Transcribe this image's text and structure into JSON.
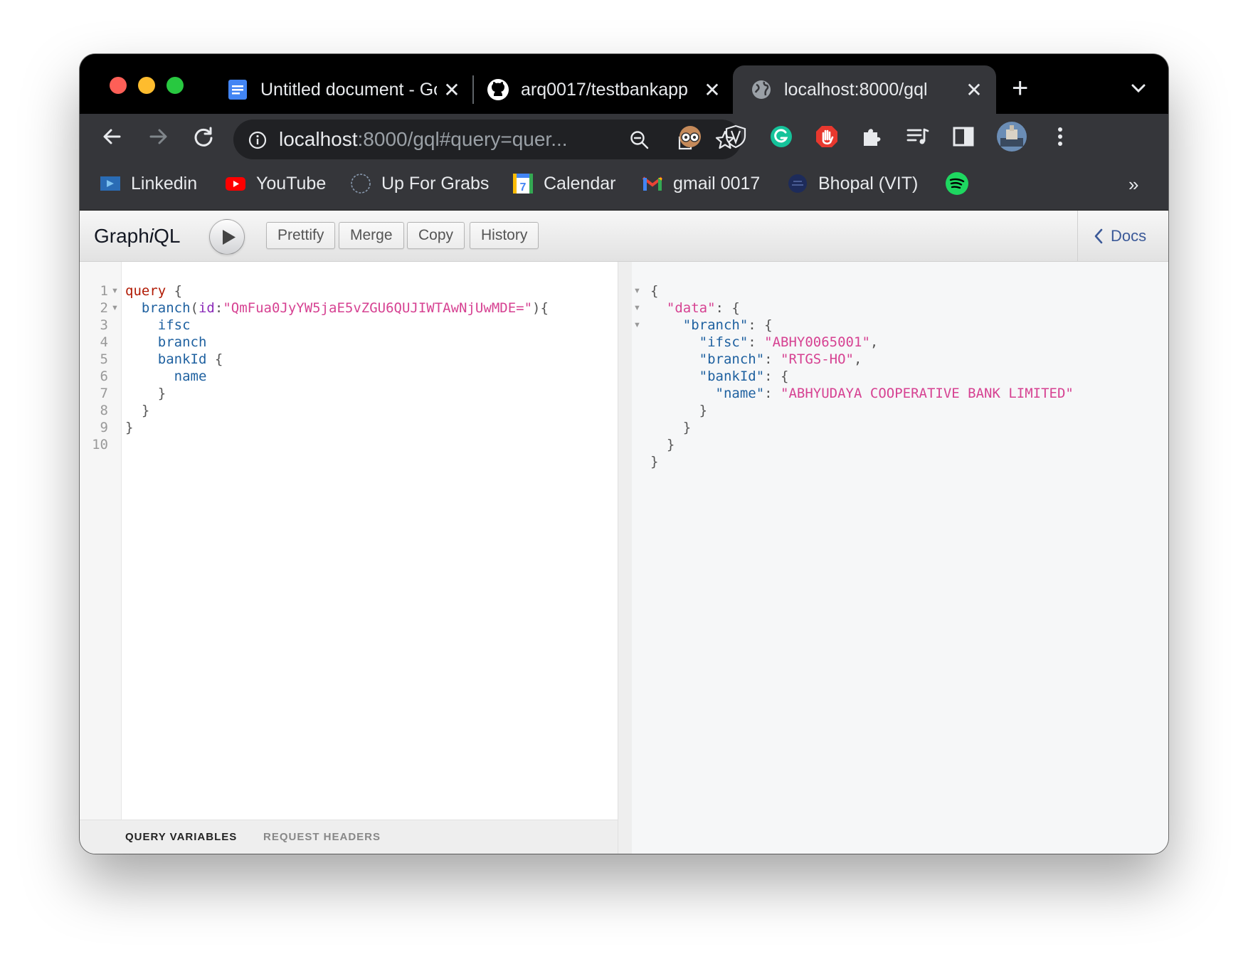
{
  "browser": {
    "tabs": [
      {
        "title": "Untitled document - Google Docs",
        "icon": "google-docs-icon"
      },
      {
        "title": "arq0017/testbankapp",
        "icon": "github-icon"
      },
      {
        "title": "localhost:8000/gql",
        "icon": "globe-icon",
        "active": true
      }
    ],
    "new_tab": "+",
    "address": {
      "host": "localhost",
      "rest": ":8000/gql#query=quer..."
    },
    "bookmarks": [
      {
        "label": "Linkedin",
        "icon": "linkedin-bookmark-icon"
      },
      {
        "label": "YouTube",
        "icon": "youtube-icon"
      },
      {
        "label": "Up For Grabs",
        "icon": "up-for-grabs-icon"
      },
      {
        "label": "Calendar",
        "icon": "calendar-icon",
        "badge": "7"
      },
      {
        "label": "gmail 0017",
        "icon": "gmail-icon"
      },
      {
        "label": "Bhopal (VIT)",
        "icon": "vit-icon"
      },
      {
        "label": "",
        "icon": "spotify-icon"
      }
    ],
    "bookmarks_overflow": "»"
  },
  "graphiql": {
    "title_prefix": "Graph",
    "title_italic": "i",
    "title_suffix": "QL",
    "buttons": {
      "prettify": "Prettify",
      "merge": "Merge",
      "copy": "Copy",
      "history": "History"
    },
    "docs": "Docs",
    "query_lines": [
      {
        "num": "1",
        "fold": true
      },
      {
        "num": "2",
        "fold": true
      },
      {
        "num": "3",
        "fold": false
      },
      {
        "num": "4",
        "fold": false
      },
      {
        "num": "5",
        "fold": false
      },
      {
        "num": "6",
        "fold": false
      },
      {
        "num": "7",
        "fold": false
      },
      {
        "num": "8",
        "fold": false
      },
      {
        "num": "9",
        "fold": false
      },
      {
        "num": "10",
        "fold": false
      }
    ],
    "query": {
      "keyword": "query",
      "root_field": "branch",
      "arg_name": "id",
      "arg_value": "\"QmFua0JyYW5jaE5vZGU6QUJIWTAwNjUwMDE=\"",
      "fields": [
        "ifsc",
        "branch",
        "bankId",
        "name"
      ]
    },
    "result": {
      "data_key": "\"data\"",
      "branch_key": "\"branch\"",
      "ifsc_key": "\"ifsc\"",
      "ifsc_value": "\"ABHY0065001\"",
      "branch_field_key": "\"branch\"",
      "branch_value": "\"RTGS-HO\"",
      "bankid_key": "\"bankId\"",
      "name_key": "\"name\"",
      "name_value": "\"ABHYUDAYA COOPERATIVE BANK LIMITED\""
    },
    "bottom_tabs": {
      "variables": "QUERY VARIABLES",
      "headers": "REQUEST HEADERS"
    }
  },
  "colors": {
    "keyword": "#b11a04",
    "field": "#1f61a0",
    "attribute": "#8b2bb9",
    "string": "#d64292",
    "link": "#3b5998"
  }
}
